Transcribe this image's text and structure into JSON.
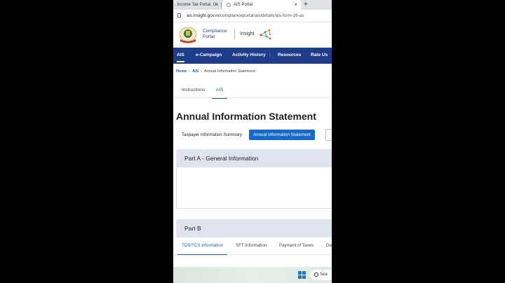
{
  "browser": {
    "tabs": [
      {
        "label": ". Income Tax Portal, G"
      },
      {
        "label": "AIS Portal"
      }
    ],
    "close_glyph": "×",
    "new_tab_glyph": "+",
    "url_host": "ais.insight.gov.in",
    "url_path": "/complianceportal/ais/details/ais-form-26-as"
  },
  "header": {
    "compliance_line1": "Compliance",
    "compliance_line2": "Portal",
    "insight": "Insight"
  },
  "nav": {
    "items": [
      {
        "label": "AIS"
      },
      {
        "label": "e-Campaign"
      },
      {
        "label": "Activity History"
      },
      {
        "label": "Resources"
      },
      {
        "label": "Rate Us"
      }
    ],
    "separator": "|"
  },
  "breadcrumb": {
    "items": [
      "Home",
      "AIS",
      "Annual Information Statement"
    ],
    "separator": "›"
  },
  "page_tabs": [
    "Instructions",
    "AIS"
  ],
  "page_title": "Annual Information Statement",
  "view_toggle": {
    "summary": "Taxpayer Information Summary",
    "statement": "Annual Information Statement"
  },
  "part_a_title": "Part A - General Information",
  "part_b_title": "Part B",
  "part_b_tabs": [
    "TDS/TCS Information",
    "SFT Information",
    "Payment of Taxes",
    "De"
  ],
  "taskbar": {
    "search_label": "Sea"
  },
  "colors": {
    "nav_bg": "#1f3c88",
    "accent": "#1669c9",
    "section_bg": "#dfe3ee"
  }
}
